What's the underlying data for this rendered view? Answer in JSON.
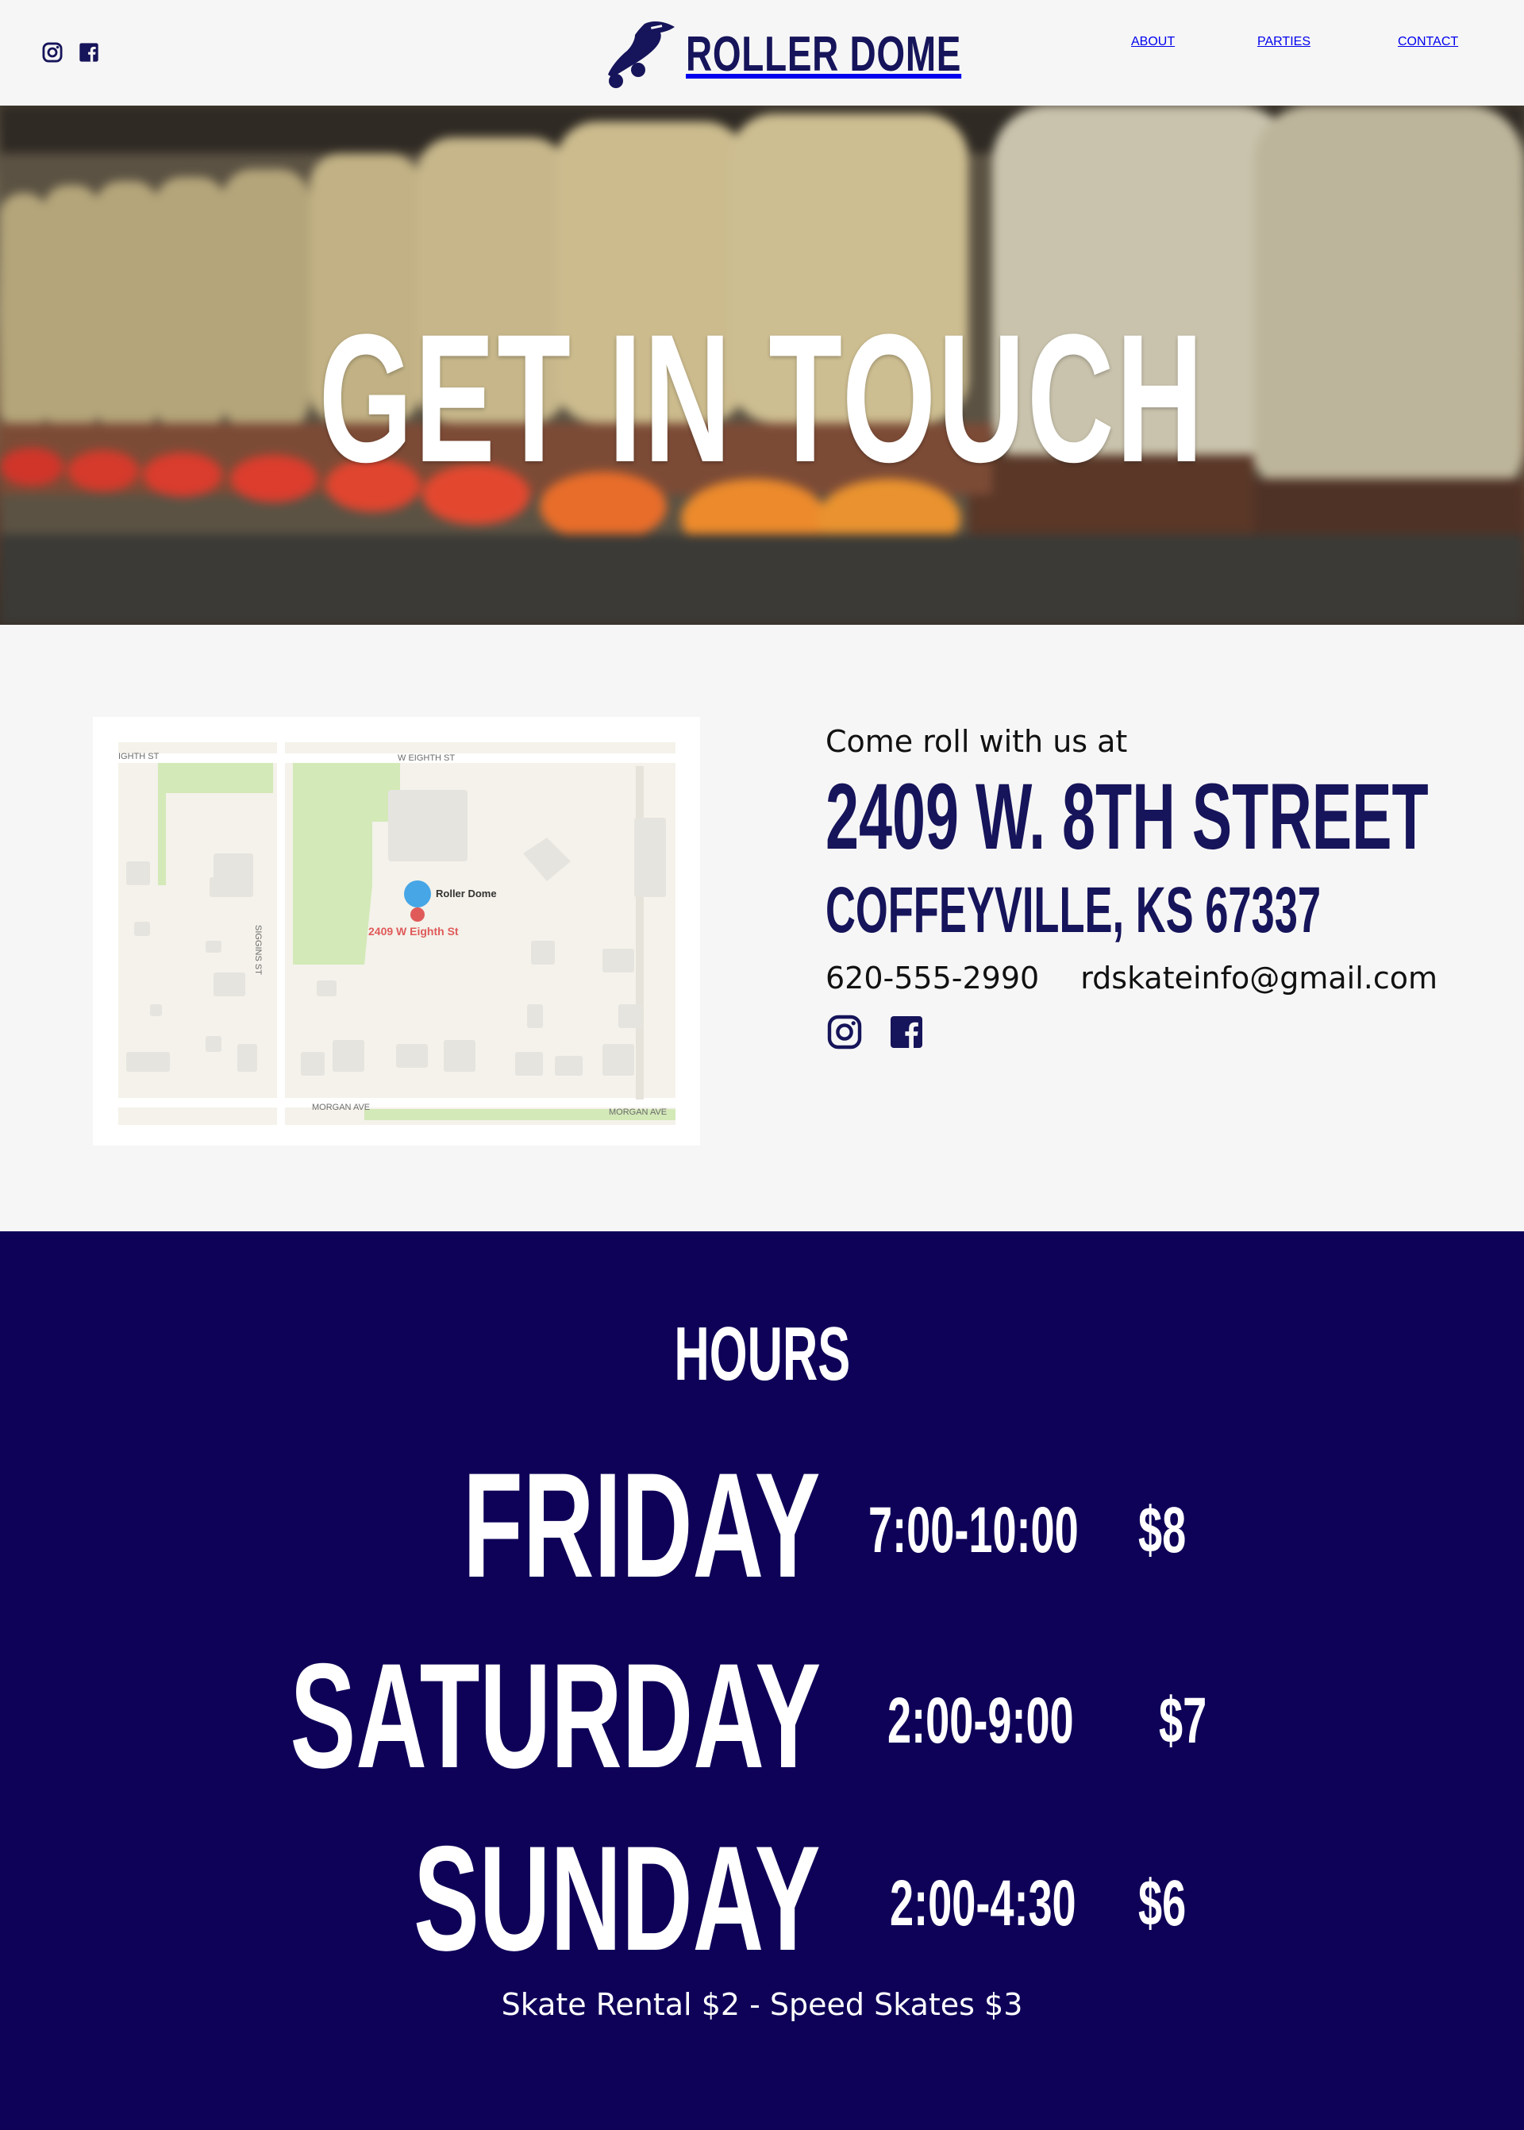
{
  "header": {
    "brand_name": "ROLLER DOME",
    "nav": {
      "about": "ABOUT",
      "parties": "PARTIES",
      "contact": "CONTACT"
    },
    "social": [
      "instagram-icon",
      "facebook-icon"
    ]
  },
  "hero": {
    "title": "GET IN TOUCH"
  },
  "map": {
    "street_top_left": "IGHTH ST",
    "street_top": "W EIGHTH ST",
    "street_side": "SIGGINS ST",
    "street_bottom_left": "MORGAN AVE",
    "street_bottom_right": "MORGAN AVE",
    "poi_name": "Roller Dome",
    "pin_label": "2409 W Eighth St"
  },
  "contact": {
    "intro": "Come roll with us at",
    "address_line1": "2409 W. 8TH STREET",
    "address_line2": "COFFEYVILLE, KS 67337",
    "phone": "620-555-2990",
    "email": "rdskateinfo@gmail.com"
  },
  "hours": {
    "title": "HOURS",
    "rows": [
      {
        "day": "FRIDAY",
        "time": "7:00-10:00",
        "price": "$8"
      },
      {
        "day": "SATURDAY",
        "time": "2:00-9:00",
        "price": "$7"
      },
      {
        "day": "SUNDAY",
        "time": "2:00-4:30",
        "price": "$6"
      }
    ],
    "rental_note": "Skate Rental $2 - Speed Skates $3"
  },
  "colors": {
    "brand_navy": "#16145a",
    "hours_bg": "#0e0258",
    "page_bg": "#f6f6f6"
  }
}
